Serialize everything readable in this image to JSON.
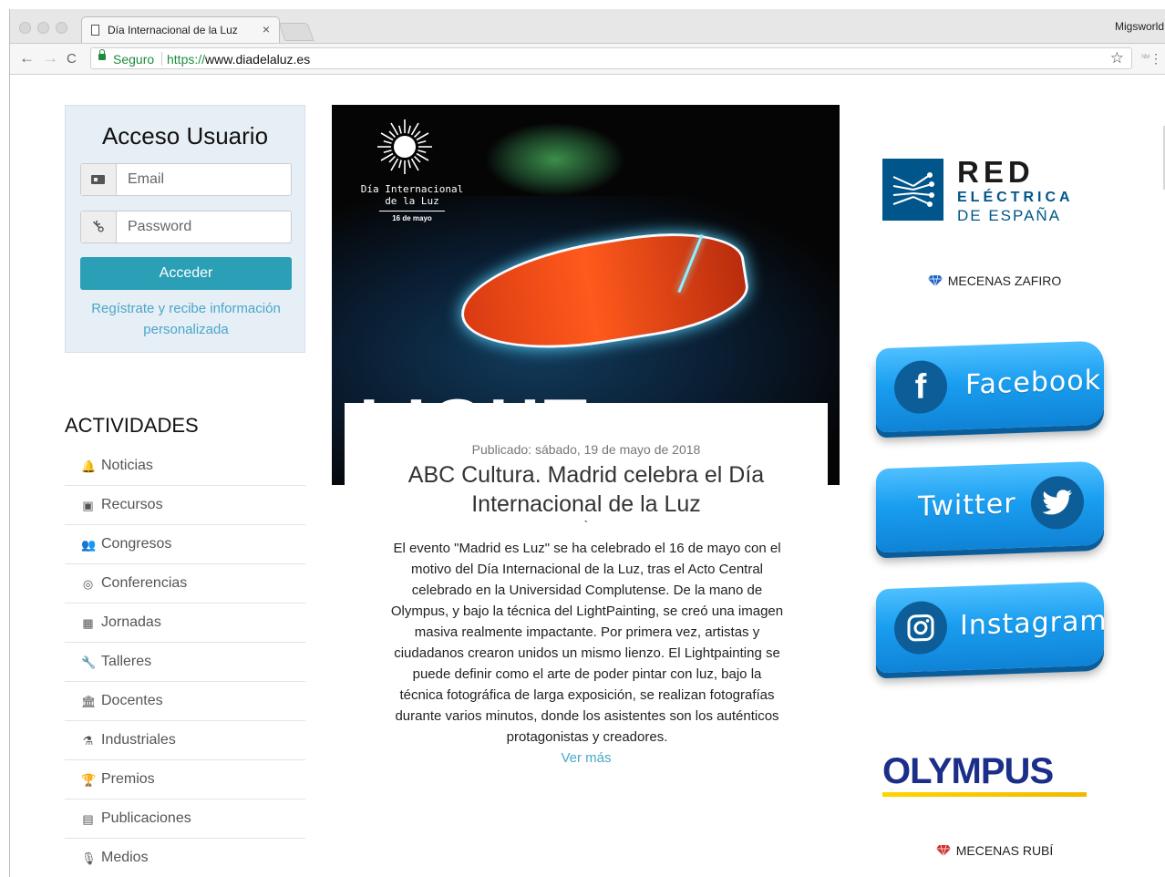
{
  "browser": {
    "tab_title": "Día Internacional de la Luz",
    "tab_close": "×",
    "profile": "Migsworld",
    "secure_label": "Seguro",
    "url_scheme": "https://",
    "url_host": "www.diadelaluz.es",
    "nav_back": "←",
    "nav_forward": "→",
    "nav_reload": "C",
    "bookmark": "☆",
    "extension": "ᴺᴹ",
    "menu": "⋮"
  },
  "login": {
    "title": "Acceso Usuario",
    "email_placeholder": "Email",
    "password_placeholder": "Password",
    "submit_label": "Acceder",
    "register_link": "Regístrate y recibe información personalizada"
  },
  "activities": {
    "title": "ACTIVIDADES",
    "items": [
      {
        "label": "Noticias",
        "icon": "bell-icon"
      },
      {
        "label": "Recursos",
        "icon": "box-icon"
      },
      {
        "label": "Congresos",
        "icon": "users-icon"
      },
      {
        "label": "Conferencias",
        "icon": "podcast-icon"
      },
      {
        "label": "Jornadas",
        "icon": "calendar-icon"
      },
      {
        "label": "Talleres",
        "icon": "wrench-icon"
      },
      {
        "label": "Docentes",
        "icon": "university-icon"
      },
      {
        "label": "Industriales",
        "icon": "flask-icon"
      },
      {
        "label": "Premios",
        "icon": "trophy-icon"
      },
      {
        "label": "Publicaciones",
        "icon": "book-icon"
      },
      {
        "label": "Medios",
        "icon": "microphone-icon"
      }
    ]
  },
  "hero": {
    "logo_line1": "Día Internacional",
    "logo_line2": "de la Luz",
    "logo_date": "16 de mayo",
    "big_word": "LIGHT"
  },
  "article": {
    "published": "Publicado: sábado, 19 de mayo de 2018",
    "title": "ABC Cultura. Madrid celebra el Día Internacional de la Luz",
    "tick": "`",
    "body": "El evento \"Madrid es Luz\" se ha celebrado el 16 de mayo con el motivo del Día Internacional de la Luz, tras el Acto Central celebrado en la Universidad Complutense. De la mano de Olympus, y bajo la técnica del LightPainting, se creó una imagen masiva realmente impactante. Por primera vez, artistas y ciudadanos crearon unidos un mismo lienzo. El Lightpainting se puede definir como el arte de poder pintar con luz, bajo la técnica fotográfica de larga exposición, se realizan fotografías durante varios minutos, donde los asistentes son los auténticos protagonistas y creadores.",
    "read_more": "Ver más"
  },
  "sponsors": {
    "ree_line1": "RED",
    "ree_line2": "ELÉCTRICA",
    "ree_line3": "DE ESPAÑA",
    "tier_zafiro": "MECENAS ZAFIRO",
    "olympus": "OLYMPUS",
    "tier_rubi": "MECENAS RUBÍ",
    "zafiro_color": "#1e63c9",
    "rubi_color": "#d42a2a"
  },
  "social": {
    "facebook": "Facebook",
    "facebook_glyph": "f",
    "twitter": "Twitter",
    "instagram": "Instagram"
  }
}
